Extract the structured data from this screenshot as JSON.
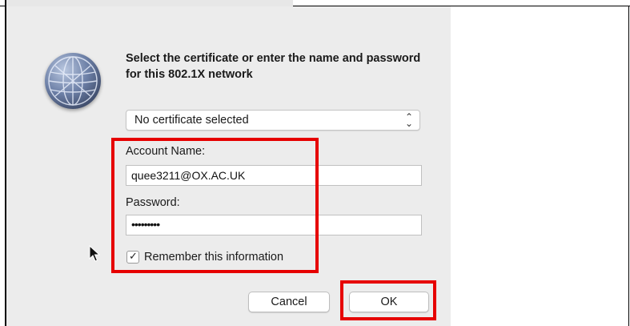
{
  "dialog": {
    "prompt": "Select the certificate or enter the name and password for this 802.1X network",
    "certificate_select": {
      "selected": "No certificate selected"
    },
    "account_name": {
      "label": "Account Name:",
      "value": "quee3211@OX.AC.UK"
    },
    "password": {
      "label": "Password:",
      "masked_value": "•••••••••"
    },
    "remember": {
      "label": "Remember this information",
      "checked": true,
      "check_glyph": "✓"
    },
    "buttons": {
      "cancel": "Cancel",
      "ok": "OK"
    }
  },
  "icons": {
    "network": "network-globe-icon",
    "select_arrows": "updown-chevron-icon",
    "cursor": "mouse-pointer-icon"
  },
  "colors": {
    "highlight": "#e60000",
    "dialog_background": "#ececec"
  }
}
